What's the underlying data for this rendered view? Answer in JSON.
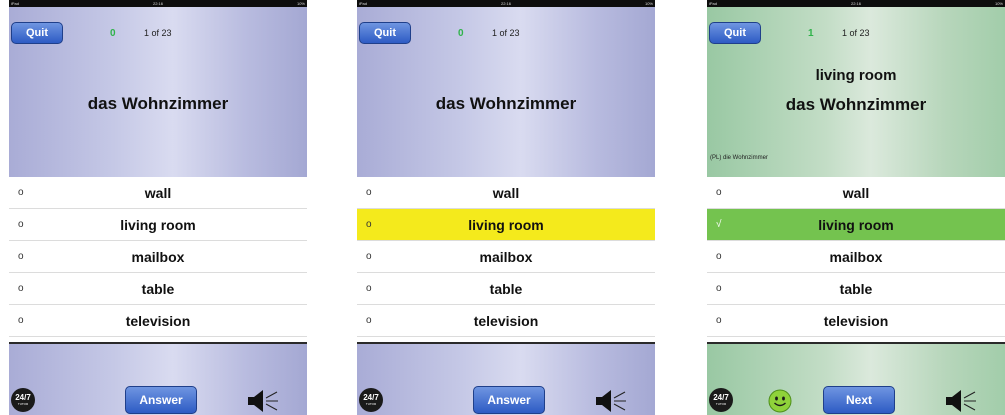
{
  "status_bar": {
    "left": "iPad",
    "time": "22:16",
    "battery": "10%"
  },
  "quit_label": "Quit",
  "progress": "1 of 23",
  "term": "das Wohnzimmer",
  "options": [
    "wall",
    "living room",
    "mailbox",
    "table",
    "television"
  ],
  "radio_glyph": "o",
  "check_glyph": "√",
  "tutor_logo": {
    "main": "24/7",
    "sub": "TUTOR"
  },
  "screens": [
    {
      "score": "0",
      "action_label": "Answer",
      "selected_option": null,
      "state": "question"
    },
    {
      "score": "0",
      "action_label": "Answer",
      "selected_option": 1,
      "state": "selected"
    },
    {
      "score": "1",
      "action_label": "Next",
      "selected_option": 1,
      "state": "correct",
      "revealed_answer": "living room",
      "plural_note": "(PL) die Wohnzimmer"
    }
  ],
  "colors": {
    "accent_blue": "#2d5bc4",
    "score_green": "#2fb34a",
    "selected_yellow": "#f4ea1c",
    "correct_green": "#74c34f"
  },
  "icons": [
    "speaker-icon",
    "smiley-icon",
    "tutor-logo"
  ]
}
